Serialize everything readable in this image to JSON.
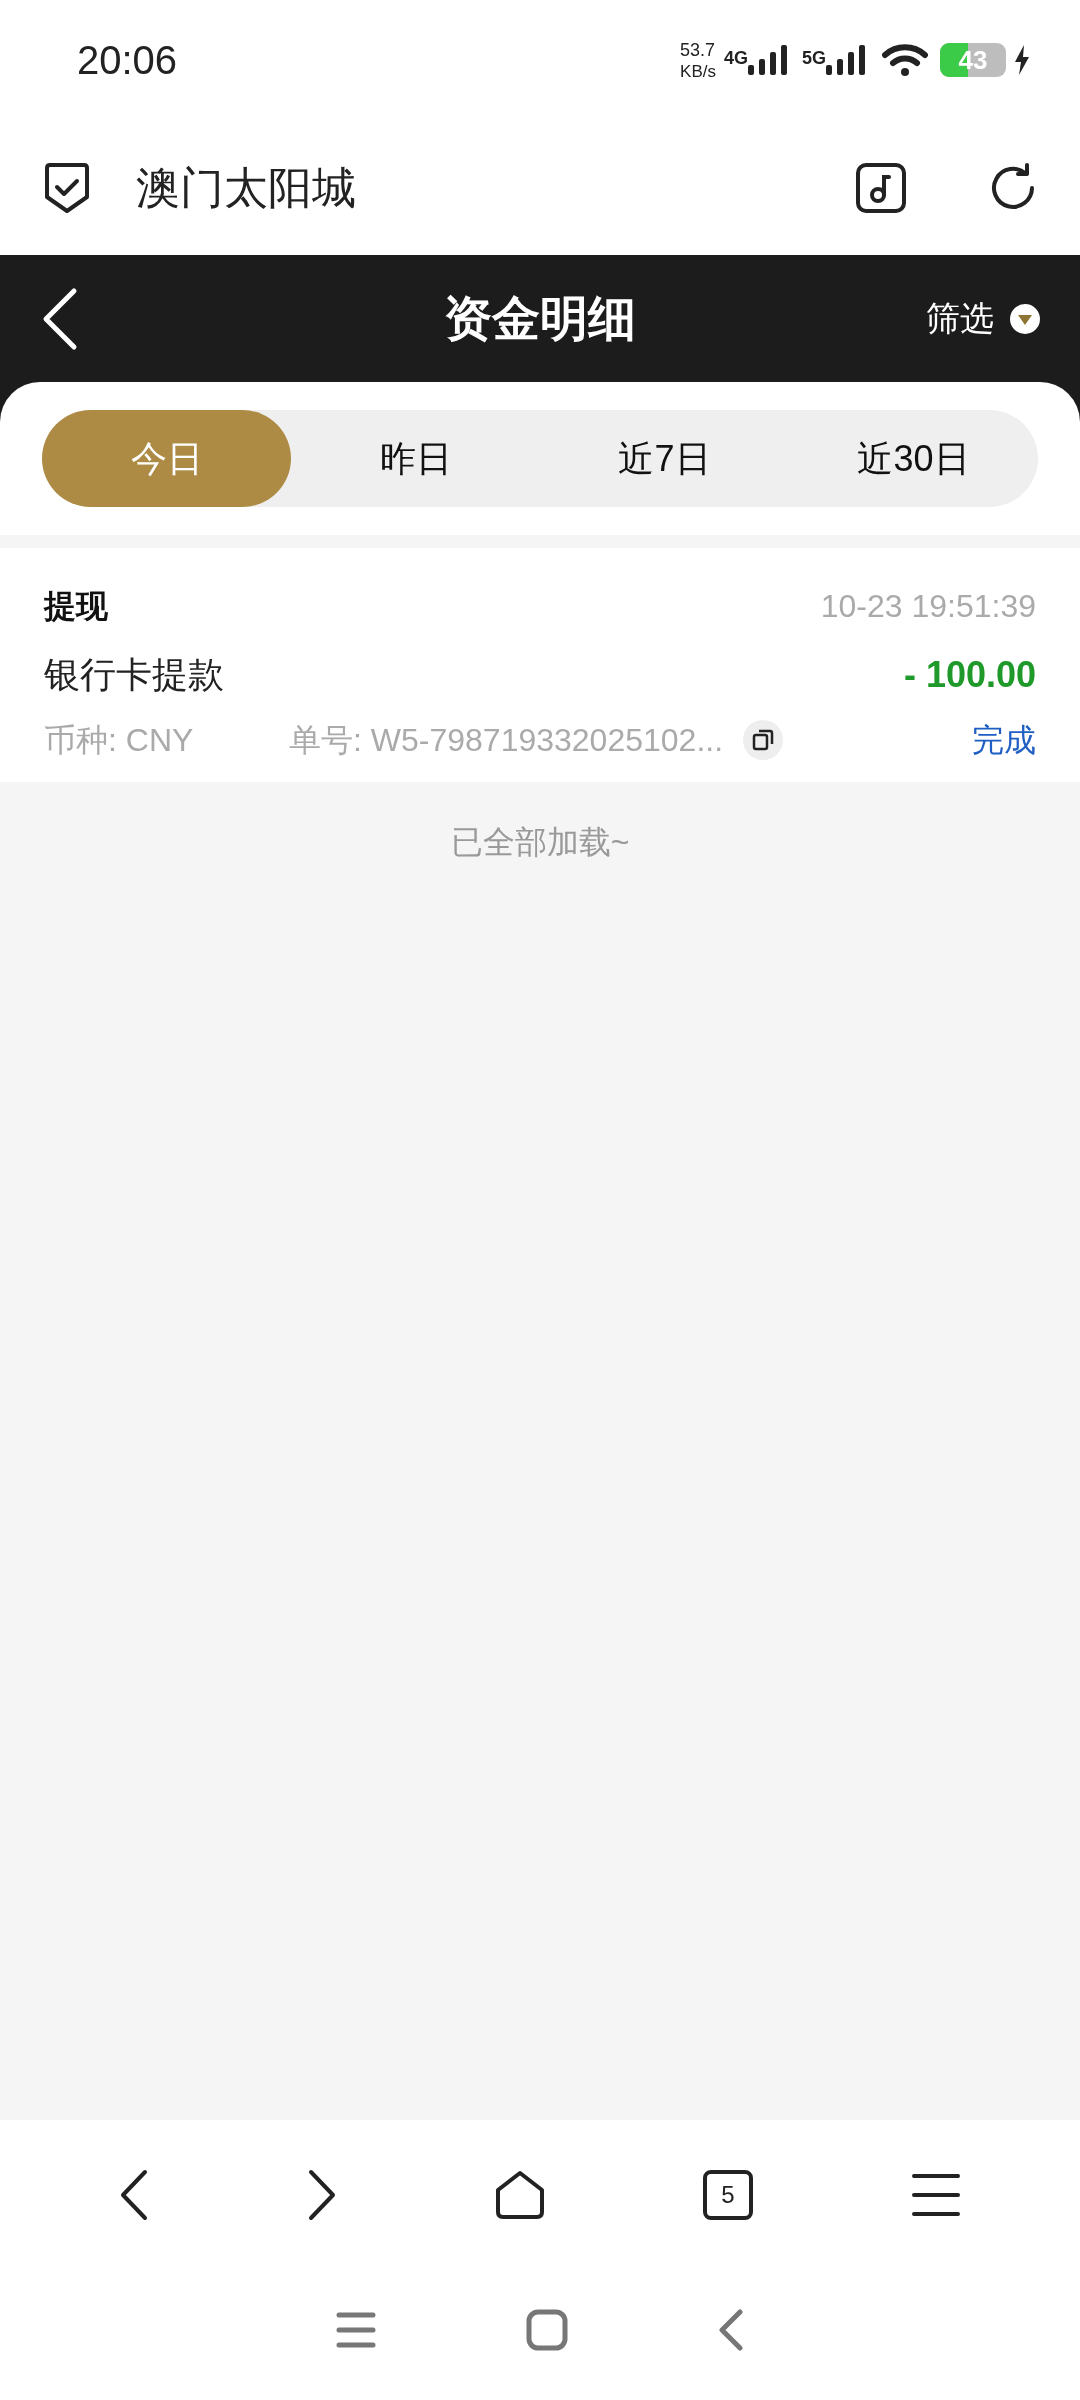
{
  "status_bar": {
    "time": "20:06",
    "speed_value": "53.7",
    "speed_unit": "KB/s",
    "network_1": "4G",
    "network_2": "5G",
    "battery": "43",
    "charging": true
  },
  "browser_header": {
    "site_title": "澳门太阳城"
  },
  "page_header": {
    "title": "资金明细",
    "filter": "筛选"
  },
  "tabs": [
    {
      "label": "今日",
      "selected": true
    },
    {
      "label": "昨日",
      "selected": false
    },
    {
      "label": "近7日",
      "selected": false
    },
    {
      "label": "近30日",
      "selected": false
    }
  ],
  "records": [
    {
      "type": "提现",
      "time": "10-23 19:51:39",
      "description": "银行卡提款",
      "amount": "- 100.00",
      "currency": "币种: CNY",
      "order_no": "单号: W5-798719332025102...",
      "status": "完成"
    }
  ],
  "end_message": "已全部加载~",
  "browser_toolbar": {
    "tab_count": "5"
  }
}
